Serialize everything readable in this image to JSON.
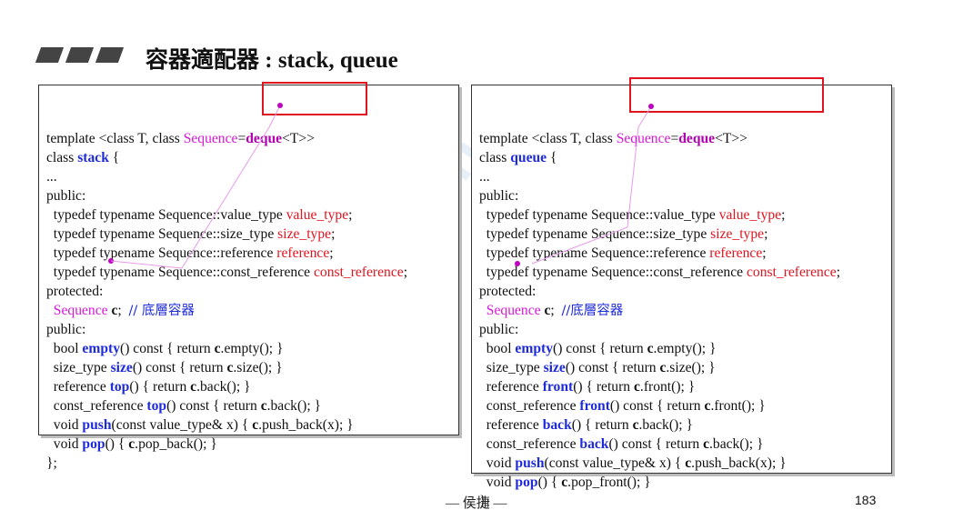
{
  "slide": {
    "title": "容器適配器 : stack, queue",
    "footer_center": "— 侯捷 —",
    "page_number": "183",
    "watermark": "Boolan"
  },
  "stack_code": {
    "lines": [
      [
        [
          "",
          "template <class T, class "
        ],
        [
          "mg",
          "Sequence"
        ],
        [
          "",
          "="
        ],
        [
          "mgb",
          "deque"
        ],
        [
          "",
          "<T>>"
        ]
      ],
      [
        [
          "",
          "class "
        ],
        [
          "kw",
          "stack"
        ],
        [
          "",
          " {"
        ]
      ],
      [
        [
          "",
          "..."
        ]
      ],
      [
        [
          "",
          "public:"
        ]
      ],
      [
        [
          "",
          "  typedef typename Sequence::value_type "
        ],
        [
          "rd",
          "value_type"
        ],
        [
          "",
          ";"
        ]
      ],
      [
        [
          "",
          "  typedef typename Sequence::size_type "
        ],
        [
          "rd",
          "size_type"
        ],
        [
          "",
          ";"
        ]
      ],
      [
        [
          "",
          "  typedef typename Sequence::reference "
        ],
        [
          "rd",
          "reference"
        ],
        [
          "",
          ";"
        ]
      ],
      [
        [
          "",
          "  typedef typename Sequence::const_reference "
        ],
        [
          "rd",
          "const_reference"
        ],
        [
          "",
          ";"
        ]
      ],
      [
        [
          "",
          "protected:"
        ]
      ],
      [
        [
          "",
          "  "
        ],
        [
          "mg",
          "Sequence"
        ],
        [
          "",
          " "
        ],
        [
          "bd",
          "c"
        ],
        [
          "",
          ";  "
        ],
        [
          "cmt",
          "// 底層容器"
        ]
      ],
      [
        [
          "",
          "public:"
        ]
      ],
      [
        [
          "",
          "  bool "
        ],
        [
          "kw",
          "empty"
        ],
        [
          "",
          "() const { return "
        ],
        [
          "bd",
          "c"
        ],
        [
          "",
          ".empty(); }"
        ]
      ],
      [
        [
          "",
          "  size_type "
        ],
        [
          "kw",
          "size"
        ],
        [
          "",
          "() const { return "
        ],
        [
          "bd",
          "c"
        ],
        [
          "",
          ".size(); }"
        ]
      ],
      [
        [
          "",
          "  reference "
        ],
        [
          "kw",
          "top"
        ],
        [
          "",
          "() { return "
        ],
        [
          "bd",
          "c"
        ],
        [
          "",
          ".back(); }"
        ]
      ],
      [
        [
          "",
          "  const_reference "
        ],
        [
          "kw",
          "top"
        ],
        [
          "",
          "() const { return "
        ],
        [
          "bd",
          "c"
        ],
        [
          "",
          ".back(); }"
        ]
      ],
      [
        [
          "",
          "  void "
        ],
        [
          "kw",
          "push"
        ],
        [
          "",
          "(const value_type& x) { "
        ],
        [
          "bd",
          "c"
        ],
        [
          "",
          ".push_back(x); }"
        ]
      ],
      [
        [
          "",
          "  void "
        ],
        [
          "kw",
          "pop"
        ],
        [
          "",
          "() { "
        ],
        [
          "bd",
          "c"
        ],
        [
          "",
          ".pop_back(); }"
        ]
      ],
      [
        [
          "",
          "};"
        ]
      ]
    ]
  },
  "queue_code": {
    "lines": [
      [
        [
          "",
          "template <class T, class "
        ],
        [
          "mg",
          "Sequence"
        ],
        [
          "",
          "="
        ],
        [
          "mgb",
          "deque"
        ],
        [
          "",
          "<T>>"
        ]
      ],
      [
        [
          "",
          "class "
        ],
        [
          "kw",
          "queue"
        ],
        [
          "",
          " {"
        ]
      ],
      [
        [
          "",
          "..."
        ]
      ],
      [
        [
          "",
          "public:"
        ]
      ],
      [
        [
          "",
          "  typedef typename Sequence::value_type "
        ],
        [
          "rd",
          "value_type"
        ],
        [
          "",
          ";"
        ]
      ],
      [
        [
          "",
          "  typedef typename Sequence::size_type "
        ],
        [
          "rd",
          "size_type"
        ],
        [
          "",
          ";"
        ]
      ],
      [
        [
          "",
          "  typedef typename Sequence::reference "
        ],
        [
          "rd",
          "reference"
        ],
        [
          "",
          ";"
        ]
      ],
      [
        [
          "",
          "  typedef typename Sequence::const_reference "
        ],
        [
          "rd",
          "const_reference"
        ],
        [
          "",
          ";"
        ]
      ],
      [
        [
          "",
          "protected:"
        ]
      ],
      [
        [
          "",
          "  "
        ],
        [
          "mg",
          "Sequence"
        ],
        [
          "",
          " "
        ],
        [
          "bd",
          "c"
        ],
        [
          "",
          ";  "
        ],
        [
          "cmt",
          "//底層容器"
        ]
      ],
      [
        [
          "",
          "public:"
        ]
      ],
      [
        [
          "",
          "  bool "
        ],
        [
          "kw",
          "empty"
        ],
        [
          "",
          "() const { return "
        ],
        [
          "bd",
          "c"
        ],
        [
          "",
          ".empty(); }"
        ]
      ],
      [
        [
          "",
          "  size_type "
        ],
        [
          "kw",
          "size"
        ],
        [
          "",
          "() const { return "
        ],
        [
          "bd",
          "c"
        ],
        [
          "",
          ".size(); }"
        ]
      ],
      [
        [
          "",
          "  reference "
        ],
        [
          "kw",
          "front"
        ],
        [
          "",
          "() { return "
        ],
        [
          "bd",
          "c"
        ],
        [
          "",
          ".front(); }"
        ]
      ],
      [
        [
          "",
          "  const_reference "
        ],
        [
          "kw",
          "front"
        ],
        [
          "",
          "() const { return "
        ],
        [
          "bd",
          "c"
        ],
        [
          "",
          ".front(); }"
        ]
      ],
      [
        [
          "",
          "  reference "
        ],
        [
          "kw",
          "back"
        ],
        [
          "",
          "() { return "
        ],
        [
          "bd",
          "c"
        ],
        [
          "",
          ".back(); }"
        ]
      ],
      [
        [
          "",
          "  const_reference "
        ],
        [
          "kw",
          "back"
        ],
        [
          "",
          "() const { return "
        ],
        [
          "bd",
          "c"
        ],
        [
          "",
          ".back(); }"
        ]
      ],
      [
        [
          "",
          "  void "
        ],
        [
          "kw",
          "push"
        ],
        [
          "",
          "(const value_type& x) { "
        ],
        [
          "bd",
          "c"
        ],
        [
          "",
          ".push_back(x); }"
        ]
      ],
      [
        [
          "",
          "  void "
        ],
        [
          "kw",
          "pop"
        ],
        [
          "",
          "() { "
        ],
        [
          "bd",
          "c"
        ],
        [
          "",
          ".pop_front(); }"
        ]
      ],
      [
        [
          "",
          "};"
        ]
      ]
    ]
  },
  "colors": {
    "keyword_blue": "#1e2bd9",
    "sequence_magenta": "#d618d6",
    "typedef_red": "#e0141e",
    "highlight_box_red": "#e0141e"
  }
}
